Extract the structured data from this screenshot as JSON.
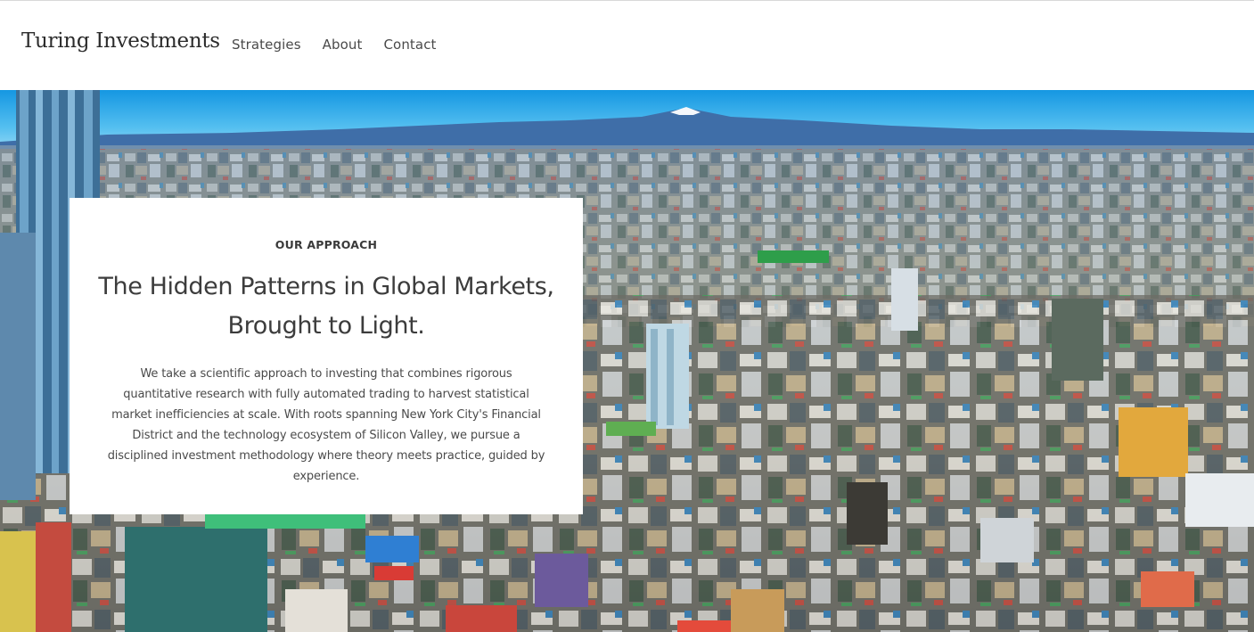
{
  "header": {
    "brand": "Turing Investments",
    "nav": {
      "strategies": "Strategies",
      "about": "About",
      "contact": "Contact"
    }
  },
  "hero": {
    "image": "city-skyline-photo",
    "card": {
      "eyebrow": "OUR APPROACH",
      "headline_line1": "The Hidden Patterns in Global Markets,",
      "headline_line2": "Brought to Light.",
      "body": "We take a scientific approach to investing that combines rigorous quantitative research with fully automated trading to harvest statistical market inefficiencies at scale. With roots spanning New York City's Financial District and the technology ecosystem of Silicon Valley, we pursue a disciplined investment methodology where theory meets practice, guided by experience."
    }
  },
  "colors": {
    "sky_top": "#1b9fe6",
    "sky_bottom": "#7fd0f5",
    "mountains": "#3f6ea8",
    "text_dark": "#3c3c3c"
  }
}
